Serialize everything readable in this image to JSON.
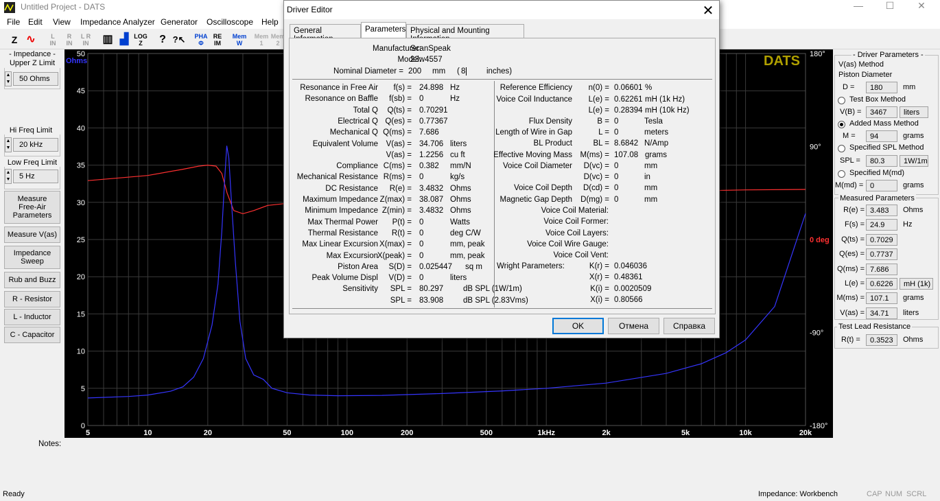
{
  "app": {
    "title": "Untitled Project - DATS",
    "min": "—",
    "max": "☐",
    "close": "✕"
  },
  "menu": [
    "File",
    "Edit",
    "View",
    "Impedance Analyzer",
    "Generator",
    "Oscilloscope",
    "Help"
  ],
  "toolbar": [
    {
      "label": "Z",
      "icon": "impedance-icon"
    },
    {
      "label": "∿",
      "icon": "sine-icon"
    },
    {
      "label": "L\nIN",
      "icon": "lin-icon"
    },
    {
      "label": "R\nIN",
      "icon": "rin-icon"
    },
    {
      "label": "L R\nIN",
      "icon": "lrin-icon"
    },
    {
      "label": "▥",
      "icon": "bars-icon"
    },
    {
      "label": "▟",
      "icon": "spectrum-icon"
    },
    {
      "label": "LOG\nZ",
      "icon": "logz-icon"
    },
    {
      "label": "?",
      "icon": "help-icon"
    },
    {
      "label": "?↖",
      "icon": "context-help-icon"
    },
    {
      "label": "PHA\nΦ",
      "icon": "phase-icon"
    },
    {
      "label": "RE\nIM",
      "icon": "reim-icon"
    },
    {
      "label": "Mem\nW",
      "icon": "memw-icon"
    },
    {
      "label": "Mem\n1",
      "icon": "mem1-icon"
    },
    {
      "label": "Mem\n2",
      "icon": "mem2-icon"
    }
  ],
  "left": {
    "upper_label": "- Impedance -\nUpper Z Limit",
    "upper_value": "50 Ohms",
    "hi_label": "Hi Freq Limit",
    "hi_value": "20 kHz",
    "low_label": "Low Freq Limit",
    "low_value": "5 Hz",
    "buttons": [
      "Measure\nFree-Air\nParameters",
      "Measure V(as)",
      "Impedance\nSweep",
      "Rub and Buzz",
      "R - Resistor",
      "L - Inductor",
      "C - Capacitor"
    ],
    "notes": "Notes:"
  },
  "chart_data": {
    "type": "line",
    "brand": "DATS",
    "ylabel": "Ohms",
    "y2label": "deg",
    "ylim": [
      0,
      50
    ],
    "y2lim": [
      -180,
      180
    ],
    "xscale": "log",
    "xlim": [
      5,
      20000
    ],
    "yticks": [
      0,
      5,
      10,
      15,
      20,
      25,
      30,
      35,
      40,
      45,
      50
    ],
    "y2ticks": [
      {
        "v": 180,
        "t": "180°"
      },
      {
        "v": 90,
        "t": "90°"
      },
      {
        "v": 0,
        "t": "0 deg"
      },
      {
        "v": -90,
        "t": "-90°"
      },
      {
        "v": -180,
        "t": "-180°"
      }
    ],
    "xticks": [
      {
        "v": 5,
        "t": "5"
      },
      {
        "v": 10,
        "t": "10"
      },
      {
        "v": 20,
        "t": "20"
      },
      {
        "v": 50,
        "t": "50"
      },
      {
        "v": 100,
        "t": "100"
      },
      {
        "v": 200,
        "t": "200"
      },
      {
        "v": 500,
        "t": "500"
      },
      {
        "v": 1000,
        "t": "1kHz"
      },
      {
        "v": 2000,
        "t": "2k"
      },
      {
        "v": 5000,
        "t": "5k"
      },
      {
        "v": 10000,
        "t": "10k"
      },
      {
        "v": 20000,
        "t": "20k"
      }
    ],
    "colors": {
      "impedance": "#3535ff",
      "phase": "#ff3030",
      "grid": "#3a3a3a",
      "brand": "#b0a000",
      "axis_left": "#3535ff",
      "axis_right": "#ff3030"
    },
    "series": [
      {
        "key": "impedance",
        "x": [
          5,
          8,
          10,
          13,
          15,
          17,
          19,
          21,
          22.5,
          23.5,
          24.3,
          24.9,
          25.5,
          26.3,
          27.5,
          29,
          31,
          34,
          38,
          42,
          50,
          65,
          90,
          150,
          300,
          600,
          1000,
          2000,
          4000,
          6000,
          8000,
          10000,
          14000,
          20000
        ],
        "values": [
          3.7,
          3.9,
          4.1,
          4.6,
          5.2,
          6.5,
          9,
          13.5,
          19,
          26,
          33,
          37.6,
          36,
          30,
          22,
          14,
          9,
          6.8,
          6.2,
          5,
          4.4,
          4.1,
          4.0,
          4.05,
          4.3,
          4.65,
          5.0,
          5.7,
          7.0,
          8.3,
          9.8,
          11.5,
          16,
          28.5
        ]
      },
      {
        "key": "phase",
        "x": [
          5,
          10,
          15,
          18,
          20,
          22,
          23.5,
          25,
          27,
          30,
          34,
          40,
          50,
          100,
          300,
          1000,
          3000,
          10000,
          20000
        ],
        "values": [
          57,
          62,
          68,
          71,
          72,
          71,
          64,
          45,
          28,
          25,
          28,
          33,
          35,
          40,
          43,
          45,
          46,
          48,
          48.5
        ]
      }
    ]
  },
  "right": {
    "title": "- Driver Parameters -",
    "method": "V(as) Method",
    "piston": "Piston Diameter",
    "d_label": "D =",
    "d_value": "180",
    "d_unit": "mm",
    "testbox": "Test Box Method",
    "vb_label": "V(B) =",
    "vb_value": "3467",
    "vb_unit": "liters",
    "addedmass": "Added Mass Method",
    "m_label": "M =",
    "m_value": "94",
    "m_unit": "grams",
    "specspl": "Specified SPL Method",
    "spl_label": "SPL =",
    "spl_value": "80.3",
    "spl_unit": "1W/1m",
    "specmmd": "Specified M(md)",
    "mmd_label": "M(md) =",
    "mmd_value": "0",
    "mmd_unit": "grams",
    "measured": "Measured Parameters",
    "rows": [
      {
        "l": "R(e) =",
        "v": "3.483",
        "u": "Ohms"
      },
      {
        "l": "F(s) =",
        "v": "24.9",
        "u": "Hz"
      },
      {
        "l": "Q(ts) =",
        "v": "0.7029",
        "u": ""
      },
      {
        "l": "Q(es) =",
        "v": "0.7737",
        "u": ""
      },
      {
        "l": "Q(ms) =",
        "v": "7.686",
        "u": ""
      },
      {
        "l": "L(e) =",
        "v": "0.6226",
        "u": "mH (1k)"
      },
      {
        "l": "M(ms) =",
        "v": "107.1",
        "u": "grams"
      },
      {
        "l": "V(as) =",
        "v": "34.71",
        "u": "liters"
      }
    ],
    "lead": "Test Lead Resistance",
    "rt_label": "R(t) =",
    "rt_value": "0.3523",
    "rt_unit": "Ohms"
  },
  "status": {
    "left": "Ready",
    "mode": "Impedance: Workbench",
    "cap": "CAP",
    "num": "NUM",
    "scrl": "SCRL"
  },
  "dialog": {
    "title": "Driver Editor",
    "close": "✕",
    "tabs": [
      "General Information",
      "Parameters",
      "Physical and Mounting Information"
    ],
    "manufacturer_label": "Manufacturer:",
    "manufacturer": "ScanSpeak",
    "model_label": "Model:",
    "model": "23w4557",
    "diam_label": "Nominal Diameter =",
    "diam": "200",
    "diam_unit": "mm",
    "diam_open": "(",
    "diam_in": "8",
    "diam_in_unit": "inches)",
    "left_rows": [
      [
        "Resonance in Free Air",
        "f(s) =",
        "24.898",
        "Hz"
      ],
      [
        "Resonance on Baffle",
        "f(sb) =",
        "0",
        "Hz"
      ],
      [
        "Total Q",
        "Q(ts) =",
        "0.70291",
        ""
      ],
      [
        "Electrical Q",
        "Q(es) =",
        "0.77367",
        ""
      ],
      [
        "Mechanical Q",
        "Q(ms) =",
        "7.686",
        ""
      ],
      [
        "Equivalent Volume",
        "V(as) =",
        "34.706",
        "liters"
      ],
      [
        "",
        "V(as) =",
        "1.2256",
        "cu ft"
      ],
      [
        "Compliance",
        "C(ms) =",
        "0.382",
        "mm/N"
      ],
      [
        "Mechanical Resistance",
        "R(ms) =",
        "0",
        "kg/s"
      ],
      [
        "DC Resistance",
        "R(e) =",
        "3.4832",
        "Ohms"
      ],
      [
        "Maximum Impedance",
        "Z(max) =",
        "38.087",
        "Ohms"
      ],
      [
        "Minimum Impedance",
        "Z(min) =",
        "3.4832",
        "Ohms"
      ],
      [
        "Max Thermal Power",
        "P(t) =",
        "0",
        "Watts"
      ],
      [
        "Thermal Resistance",
        "R(t) =",
        "0",
        "deg C/W"
      ],
      [
        "Max Linear Excursion",
        "X(max) =",
        "0",
        "mm, peak"
      ],
      [
        "Max Excursion",
        "X(peak) =",
        "0",
        "mm, peak"
      ],
      [
        "Piston Area",
        "S(D) =",
        "0.025447",
        "sq m"
      ],
      [
        "Peak Volume Displ",
        "V(D) =",
        "0",
        "liters"
      ],
      [
        "Sensitivity",
        "SPL =",
        "80.297",
        "dB SPL (1W/1m)"
      ],
      [
        "",
        "SPL =",
        "83.908",
        "dB SPL (2.83Vms)"
      ]
    ],
    "right_rows": [
      [
        "Reference Efficiency",
        "n(0) =",
        "0.06601",
        "%"
      ],
      [
        "Voice Coil Inductance",
        "L(e) =",
        "0.62261",
        "mH (1k Hz)"
      ],
      [
        "",
        "L(e) =",
        "0.28394",
        "mH (10k Hz)"
      ],
      [
        "Flux Density",
        "B =",
        "0",
        "Tesla"
      ],
      [
        "Length of Wire in Gap",
        "L =",
        "0",
        "meters"
      ],
      [
        "BL Product",
        "BL =",
        "8.6842",
        "N/Amp"
      ],
      [
        "Effective Moving Mass",
        "M(ms) =",
        "107.08",
        "grams"
      ],
      [
        "Voice Coil Diameter",
        "D(vc) =",
        "0",
        "mm"
      ],
      [
        "",
        "D(vc) =",
        "0",
        "in"
      ],
      [
        "Voice Coil Depth",
        "D(cd) =",
        "0",
        "mm"
      ],
      [
        "Magnetic Gap Depth",
        "D(mg) =",
        "0",
        "mm"
      ]
    ],
    "right_text": [
      "Voice Coil Material:",
      "Voice Coil Former:",
      "Voice Coil Layers:",
      "Voice Coil Wire Gauge:",
      "Voice Coil Vent:"
    ],
    "wright_label": "Wright Parameters:",
    "wright_rows": [
      [
        "K(r) =",
        "0.046036"
      ],
      [
        "X(r) =",
        "0.48361"
      ],
      [
        "K(i) =",
        "0.0020509"
      ],
      [
        "X(i) =",
        "0.80566"
      ]
    ],
    "ok": "OK",
    "cancel": "Отмена",
    "help": "Справка"
  }
}
